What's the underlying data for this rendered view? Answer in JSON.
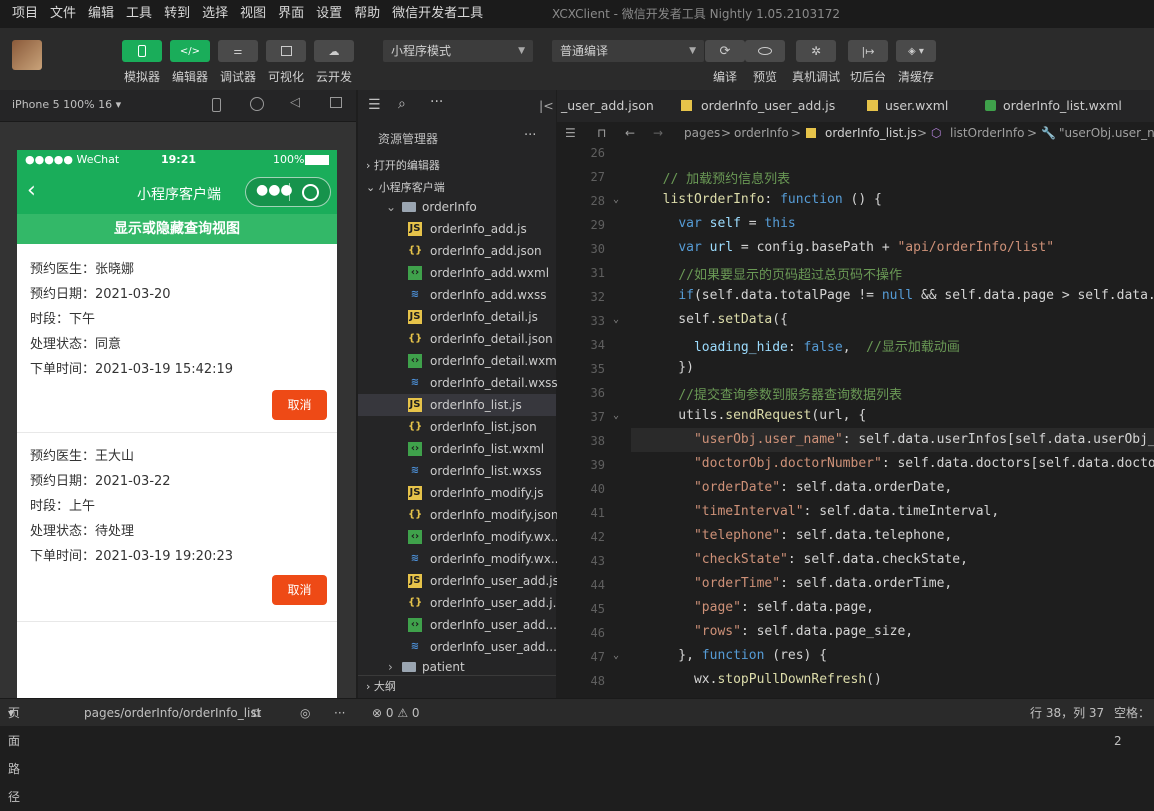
{
  "menu": [
    "项目",
    "文件",
    "编辑",
    "工具",
    "转到",
    "选择",
    "视图",
    "界面",
    "设置",
    "帮助",
    "微信开发者工具"
  ],
  "window_title": "XCXClient - 微信开发者工具 Nightly 1.05.2103172",
  "toolbar": {
    "simulator": "模拟器",
    "editor": "编辑器",
    "debugger": "调试器",
    "visual": "可视化",
    "cloud": "云开发",
    "mode_select": "小程序模式",
    "compile_select": "普通编译",
    "compile": "编译",
    "preview": "预览",
    "real_debug": "真机调试",
    "background": "切后台",
    "clear_cache": "清缓存"
  },
  "simbar": {
    "device": "iPhone 5 100% 16"
  },
  "phone": {
    "status_signal": "●●●●● WeChat",
    "status_time": "19:21",
    "status_battery": "100%",
    "nav_title": "小程序客户端",
    "subheader": "显示或隐藏查询视图",
    "orders": [
      {
        "doctor": "预约医生：张晓娜",
        "date": "预约日期：2021-03-20",
        "period": "时段：下午",
        "state": "处理状态：同意",
        "order_time": "下单时间：2021-03-19 15:42:19",
        "cancel": "取消"
      },
      {
        "doctor": "预约医生：王大山",
        "date": "预约日期：2021-03-22",
        "period": "时段：上午",
        "state": "处理状态：待处理",
        "order_time": "下单时间：2021-03-19 19:20:23",
        "cancel": "取消"
      }
    ]
  },
  "explorer": {
    "title": "资源管理器",
    "more": "···",
    "open_editors": "打开的编辑器",
    "project": "小程序客户端",
    "folder": "orderInfo",
    "files": [
      {
        "name": "orderInfo_add.js",
        "type": "js"
      },
      {
        "name": "orderInfo_add.json",
        "type": "json"
      },
      {
        "name": "orderInfo_add.wxml",
        "type": "wxml"
      },
      {
        "name": "orderInfo_add.wxss",
        "type": "wxss"
      },
      {
        "name": "orderInfo_detail.js",
        "type": "js"
      },
      {
        "name": "orderInfo_detail.json",
        "type": "json"
      },
      {
        "name": "orderInfo_detail.wxml",
        "type": "wxml"
      },
      {
        "name": "orderInfo_detail.wxss",
        "type": "wxss"
      },
      {
        "name": "orderInfo_list.js",
        "type": "js"
      },
      {
        "name": "orderInfo_list.json",
        "type": "json"
      },
      {
        "name": "orderInfo_list.wxml",
        "type": "wxml"
      },
      {
        "name": "orderInfo_list.wxss",
        "type": "wxss"
      },
      {
        "name": "orderInfo_modify.js",
        "type": "js"
      },
      {
        "name": "orderInfo_modify.json",
        "type": "json"
      },
      {
        "name": "orderInfo_modify.wx...",
        "type": "wxml"
      },
      {
        "name": "orderInfo_modify.wx...",
        "type": "wxss"
      },
      {
        "name": "orderInfo_user_add.js",
        "type": "js"
      },
      {
        "name": "orderInfo_user_add.j...",
        "type": "json"
      },
      {
        "name": "orderInfo_user_add....",
        "type": "wxml"
      },
      {
        "name": "orderInfo_user_add....",
        "type": "wxss"
      }
    ],
    "patient_folder": "patient",
    "outline": "大纲"
  },
  "tabs": [
    "_user_add.json",
    "orderInfo_user_add.js",
    "user.wxml",
    "orderInfo_list.wxml"
  ],
  "breadcrumbs": {
    "pages": "pages",
    "sep1": ">",
    "orderInfo": "orderInfo",
    "sep2": ">",
    "file": "orderInfo_list.js",
    "sep3": ">",
    "func": "listOrderInfo",
    "sep4": ">",
    "key": "\"userObj.user_na"
  },
  "code_lines": [
    {
      "n": "26",
      "html": ""
    },
    {
      "n": "27",
      "html": "  <span class='c'>// 加载预约信息列表</span>"
    },
    {
      "n": "28",
      "html": "  <span class='f'>listOrderInfo</span>: <span class='k'>function</span> () {"
    },
    {
      "n": "29",
      "html": "    <span class='k'>var</span> <span class='p'>self</span> = <span class='k'>this</span>"
    },
    {
      "n": "30",
      "html": "    <span class='k'>var</span> <span class='p'>url</span> = config.basePath + <span class='s'>\"api/orderInfo/list\"</span>"
    },
    {
      "n": "31",
      "html": "    <span class='c'>//如果要显示的页码超过总页码不操作</span>"
    },
    {
      "n": "32",
      "html": "    <span class='k'>if</span>(self.data.totalPage != <span class='k'>null</span> &amp;&amp; self.data.page &gt; self.data.tot"
    },
    {
      "n": "33",
      "html": "    self.<span class='f'>setData</span>({"
    },
    {
      "n": "34",
      "html": "      <span class='p'>loading_hide</span>: <span class='k'>false</span>,  <span class='c'>//显示加载动画</span>"
    },
    {
      "n": "35",
      "html": "    })"
    },
    {
      "n": "36",
      "html": "    <span class='c'>//提交查询参数到服务器查询数据列表</span>"
    },
    {
      "n": "37",
      "html": "    utils.<span class='f'>sendRequest</span>(url, {"
    },
    {
      "n": "38",
      "html": "      <span class='s'>\"userObj.user_name\"</span>: self.data.userInfos[self.data.userObj_Ind"
    },
    {
      "n": "39",
      "html": "      <span class='s'>\"doctorObj.doctorNumber\"</span>: self.data.doctors[self.data.doctorOb"
    },
    {
      "n": "40",
      "html": "      <span class='s'>\"orderDate\"</span>: self.data.orderDate,"
    },
    {
      "n": "41",
      "html": "      <span class='s'>\"timeInterval\"</span>: self.data.timeInterval,"
    },
    {
      "n": "42",
      "html": "      <span class='s'>\"telephone\"</span>: self.data.telephone,"
    },
    {
      "n": "43",
      "html": "      <span class='s'>\"checkState\"</span>: self.data.checkState,"
    },
    {
      "n": "44",
      "html": "      <span class='s'>\"orderTime\"</span>: self.data.orderTime,"
    },
    {
      "n": "45",
      "html": "      <span class='s'>\"page\"</span>: self.data.page,"
    },
    {
      "n": "46",
      "html": "      <span class='s'>\"rows\"</span>: self.data.page_size,"
    },
    {
      "n": "47",
      "html": "    }, <span class='k'>function</span> (res) {"
    },
    {
      "n": "48",
      "html": "      wx.<span class='f'>stopPullDownRefresh</span>()"
    }
  ],
  "statusbar": {
    "page_path_label": "页面路径",
    "page_path": "pages/orderInfo/orderInfo_list",
    "errors": "⊗ 0 ⚠ 0",
    "position": "行 38，列 37",
    "spaces": "空格：2"
  },
  "colors": {
    "accent_green": "#1aad5a",
    "cancel_red": "#ee4a16",
    "editor_bg": "#1e1e1e"
  }
}
